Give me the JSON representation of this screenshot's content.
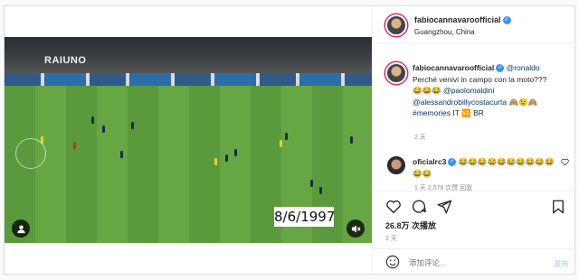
{
  "header": {
    "username": "fabiocannavaroofficial",
    "location": "Guangzhou, China"
  },
  "video": {
    "broadcaster_logo": "RAIUNO",
    "date_overlay": "8/6/1997"
  },
  "caption": {
    "username": "fabiocannavaroofficial",
    "mention_1": "@ronaldo",
    "text": "Perché venivi in campo con la moto???",
    "emoji_1": "😂😂😂",
    "mention_2": "@paolomaldini",
    "mention_3": "@alessandrobillycostacurta",
    "emoji_2": "🙈😉🙈",
    "hashtag": "#memories",
    "flags": "IT 🆚 BR",
    "time": "2 天"
  },
  "comment": {
    "username": "oficialrc3",
    "text": "😂😂😂😂😂😂😂😂😂😂😂😂",
    "meta": "1 天  2,578 次赞  回复"
  },
  "stats": {
    "views": "26.8万 次播放",
    "time_ago": "2 天"
  },
  "comment_bar": {
    "placeholder": "添加评论...",
    "post_label": "发布"
  },
  "colors": {
    "mention": "#00376b",
    "verified": "#3897f0",
    "post_disabled": "#b2dffc"
  }
}
